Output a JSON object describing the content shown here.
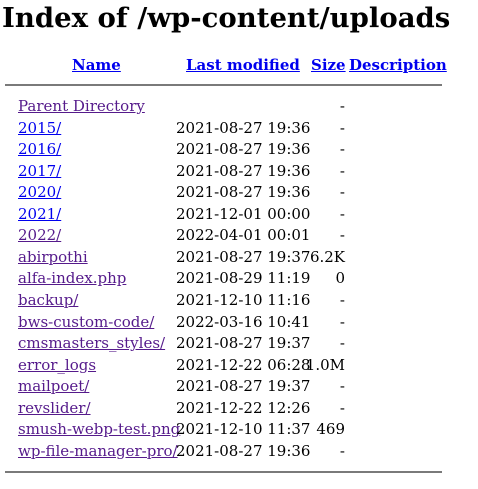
{
  "title": "Index of /wp-content/uploads",
  "columns": {
    "name": "Name",
    "last_modified": "Last modified",
    "size": "Size",
    "description": "Description"
  },
  "rows": [
    {
      "name": "Parent Directory",
      "modified": "",
      "size": "-",
      "visited": true
    },
    {
      "name": "2015/",
      "modified": "2021-08-27 19:36",
      "size": "-",
      "visited": false
    },
    {
      "name": "2016/",
      "modified": "2021-08-27 19:36",
      "size": "-",
      "visited": false
    },
    {
      "name": "2017/",
      "modified": "2021-08-27 19:36",
      "size": "-",
      "visited": false
    },
    {
      "name": "2020/",
      "modified": "2021-08-27 19:36",
      "size": "-",
      "visited": false
    },
    {
      "name": "2021/",
      "modified": "2021-12-01 00:00",
      "size": "-",
      "visited": false
    },
    {
      "name": "2022/",
      "modified": "2022-04-01 00:01",
      "size": "-",
      "visited": true
    },
    {
      "name": "abirpothi",
      "modified": "2021-08-27 19:37",
      "size": "6.2K",
      "visited": true
    },
    {
      "name": "alfa-index.php",
      "modified": "2021-08-29 11:19",
      "size": "0",
      "visited": true
    },
    {
      "name": "backup/",
      "modified": "2021-12-10 11:16",
      "size": "-",
      "visited": true
    },
    {
      "name": "bws-custom-code/",
      "modified": "2022-03-16 10:41",
      "size": "-",
      "visited": true
    },
    {
      "name": "cmsmasters_styles/",
      "modified": "2021-08-27 19:37",
      "size": "-",
      "visited": true
    },
    {
      "name": "error_logs",
      "modified": "2021-12-22 06:28",
      "size": "1.0M",
      "visited": true
    },
    {
      "name": "mailpoet/",
      "modified": "2021-08-27 19:37",
      "size": "-",
      "visited": true
    },
    {
      "name": "revslider/",
      "modified": "2021-12-22 12:26",
      "size": "-",
      "visited": true
    },
    {
      "name": "smush-webp-test.png",
      "modified": "2021-12-10 11:37",
      "size": "469",
      "visited": true
    },
    {
      "name": "wp-file-manager-pro/",
      "modified": "2021-08-27 19:36",
      "size": "-",
      "visited": true
    }
  ],
  "colors": {
    "link": "#0000ee",
    "visited_link": "#551a8b",
    "rule": "#7a7a7a"
  }
}
